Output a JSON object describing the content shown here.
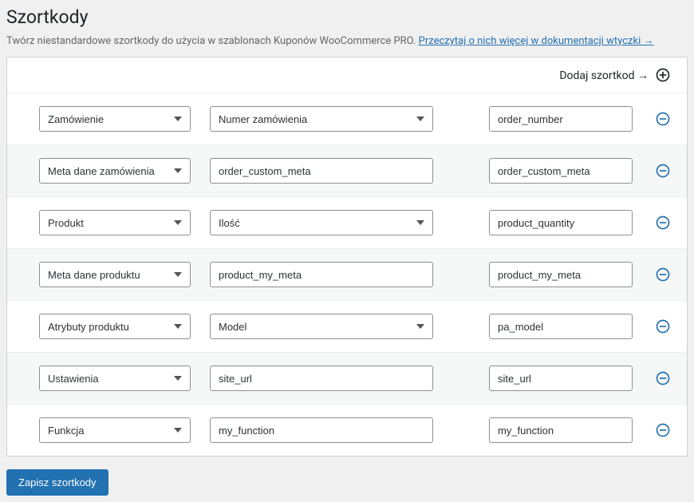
{
  "title": "Szortkody",
  "description_prefix": "Twórz niestandardowe szortkody do użycia w szablonach Kuponów WooCommerce PRO. ",
  "description_link": "Przeczytaj o nich więcej w dokumentacji wtyczki →",
  "add_label": "Dodaj szortkod →",
  "save_button": "Zapisz szortkody",
  "icons": {
    "add": "add-circle-icon",
    "remove": "remove-circle-icon"
  },
  "colors": {
    "accent": "#2271b1"
  },
  "rows": [
    {
      "type": "Zamówienie",
      "sub_kind": "select",
      "sub": "Numer zamówienia",
      "name": "order_number"
    },
    {
      "type": "Meta dane zamówienia",
      "sub_kind": "input",
      "sub": "order_custom_meta",
      "name": "order_custom_meta"
    },
    {
      "type": "Produkt",
      "sub_kind": "select",
      "sub": "Ilość",
      "name": "product_quantity"
    },
    {
      "type": "Meta dane produktu",
      "sub_kind": "input",
      "sub": "product_my_meta",
      "name": "product_my_meta"
    },
    {
      "type": "Atrybuty produktu",
      "sub_kind": "select",
      "sub": "Model",
      "name": "pa_model"
    },
    {
      "type": "Ustawienia",
      "sub_kind": "input",
      "sub": "site_url",
      "name": "site_url"
    },
    {
      "type": "Funkcja",
      "sub_kind": "input",
      "sub": "my_function",
      "name": "my_function"
    }
  ]
}
